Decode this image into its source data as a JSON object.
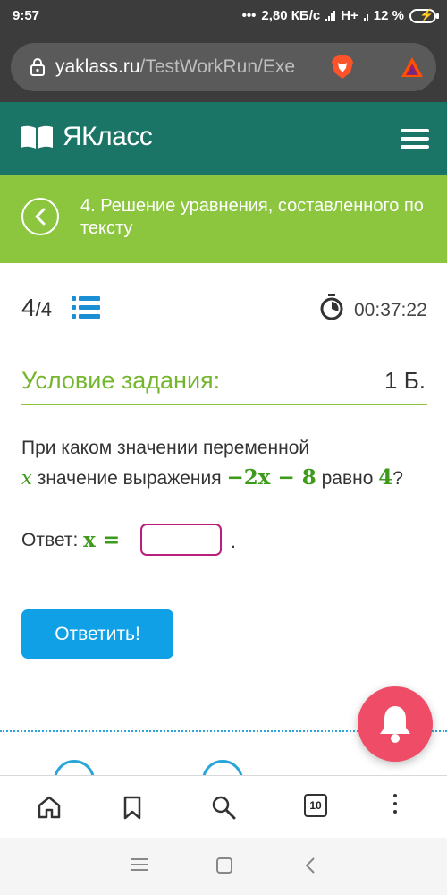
{
  "status_bar": {
    "time": "9:57",
    "network_speed": "2,80 КБ/с",
    "network_type": "H+",
    "battery": "12 %",
    "icons": [
      "dots-icon",
      "signal-icon",
      "battery-charging-icon"
    ]
  },
  "browser": {
    "url_domain": "yaklass.ru",
    "url_path": "/TestWorkRun/Exe",
    "icons": [
      "lock-icon",
      "brave-lion-icon",
      "bat-rewards-icon"
    ]
  },
  "site": {
    "logo_text": "ЯКласс",
    "icons": [
      "book-logo-icon",
      "hamburger-menu-icon"
    ]
  },
  "lesson": {
    "title": "4. Решение уравнения, составленного по тексту"
  },
  "task": {
    "progress_current": "4",
    "progress_total": "/4",
    "timer": "00:37:22",
    "condition_title": "Условие задания:",
    "points": "1 Б.",
    "question_part1": "При каком значении переменной",
    "question_var": "x",
    "question_part2": "значение выражения",
    "question_expr": "−2x − 8",
    "question_part3": "равно",
    "question_value": "4",
    "question_end": "?",
    "answer_label": "Ответ:",
    "answer_expr": "x =",
    "answer_value": "",
    "answer_suffix": ".",
    "submit_label": "Ответить!"
  },
  "bottom_nav": {
    "tabs_count": "10",
    "icons": [
      "home-icon",
      "bookmark-icon",
      "search-icon",
      "tabs-icon",
      "more-icon"
    ]
  },
  "colors": {
    "header": "#1b7566",
    "title_bar": "#8cc63f",
    "accent_green": "#74b72e",
    "submit": "#0fa0e6",
    "input_border": "#b81f7a",
    "bell": "#ef4c67"
  }
}
